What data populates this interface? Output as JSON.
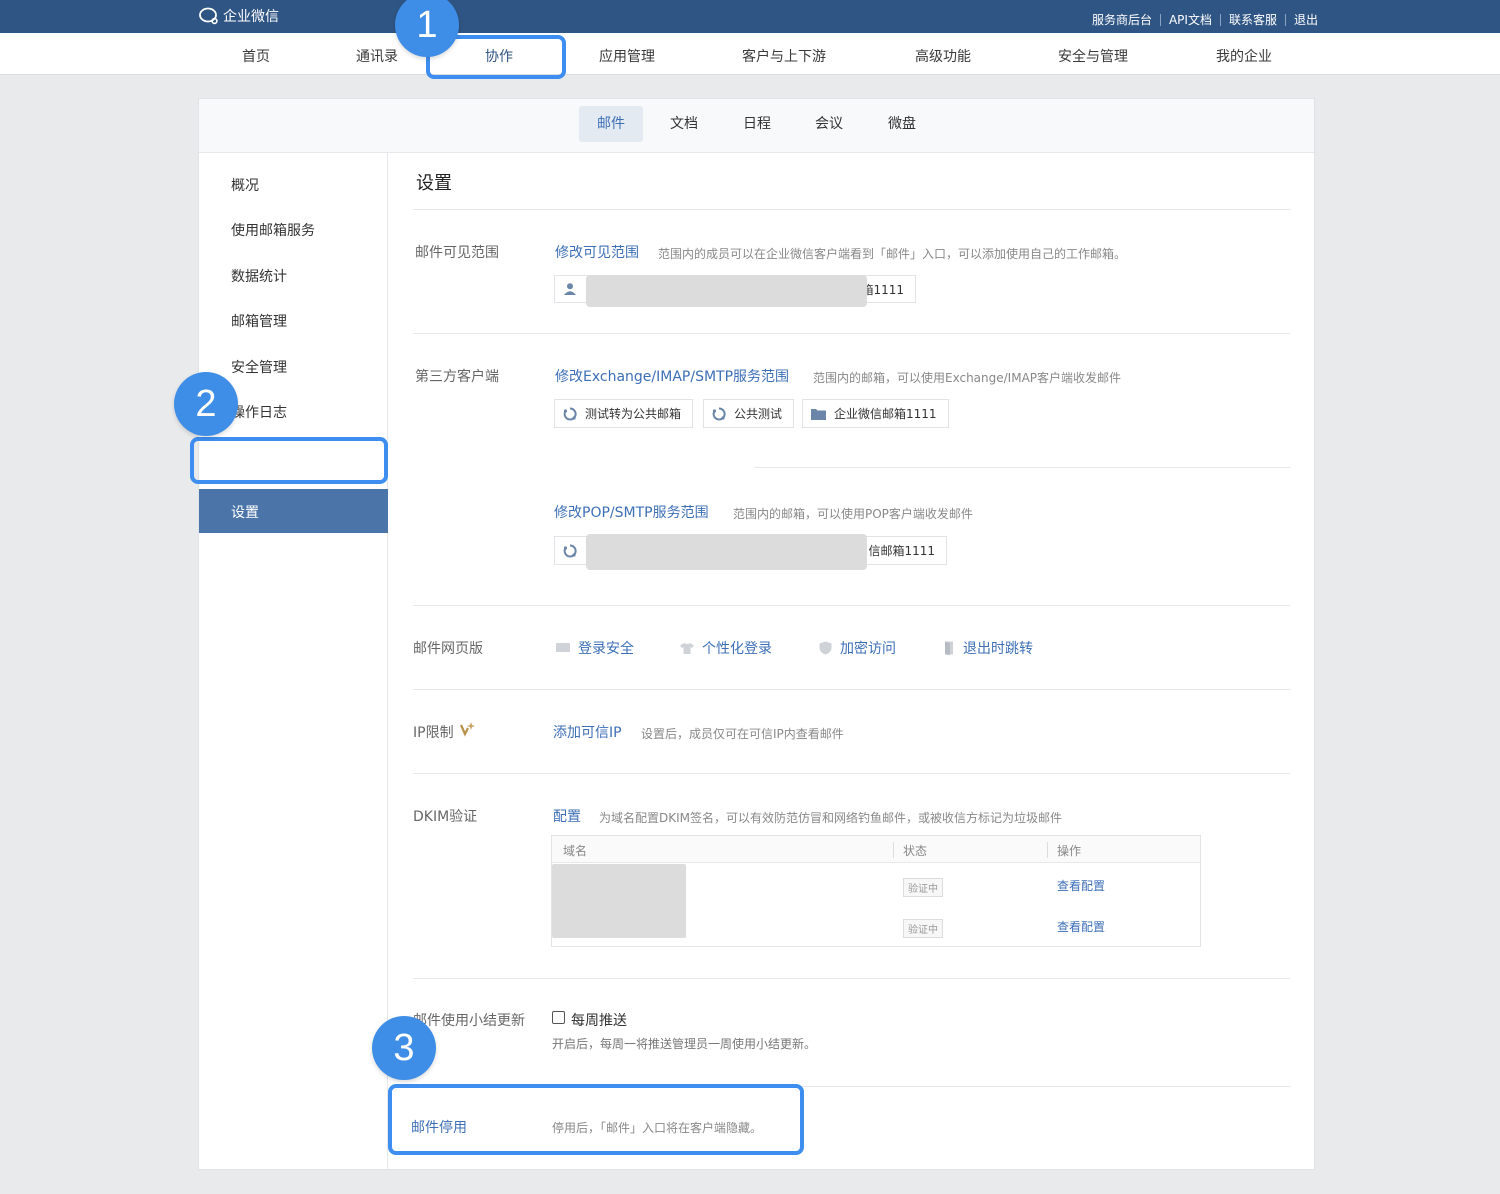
{
  "topbar": {
    "brand": "企业微信",
    "links": [
      "服务商后台",
      "API文档",
      "联系客服",
      "退出"
    ]
  },
  "mainnav": {
    "items": [
      "首页",
      "通讯录",
      "协作",
      "应用管理",
      "客户与上下游",
      "高级功能",
      "安全与管理",
      "我的企业"
    ],
    "active": "协作"
  },
  "subnav": {
    "tabs": [
      "邮件",
      "文档",
      "日程",
      "会议",
      "微盘"
    ],
    "active": "邮件"
  },
  "sidebar": {
    "items": [
      "概况",
      "使用邮箱服务",
      "数据统计",
      "邮箱管理",
      "安全管理",
      "操作日志",
      "设置"
    ],
    "active": "设置"
  },
  "content": {
    "title": "设置",
    "visibility": {
      "label": "邮件可见范围",
      "link": "修改可见范围",
      "desc": "范围内的成员可以在企业微信客户端看到「邮件」入口，可以添加使用自己的工作邮箱。",
      "chip_tail": "箱1111"
    },
    "third_party": {
      "label": "第三方客户端",
      "imap_link": "修改Exchange/IMAP/SMTP服务范围",
      "imap_desc": "范围内的邮箱，可以使用Exchange/IMAP客户端收发邮件",
      "imap_chips": [
        "测试转为公共邮箱",
        "公共测试",
        "企业微信邮箱1111"
      ],
      "pop_link": "修改POP/SMTP服务范围",
      "pop_desc": "范围内的邮箱，可以使用POP客户端收发邮件",
      "pop_chip_tail": "信邮箱1111"
    },
    "webmail": {
      "label": "邮件网页版",
      "items": [
        "登录安全",
        "个性化登录",
        "加密访问",
        "退出时跳转"
      ]
    },
    "ip": {
      "label": "IP限制",
      "link": "添加可信IP",
      "desc": "设置后，成员仅可在可信IP内查看邮件"
    },
    "dkim": {
      "label": "DKIM验证",
      "link": "配置",
      "desc": "为域名配置DKIM签名，可以有效防范仿冒和网络钓鱼邮件，或被收信方标记为垃圾邮件",
      "columns": [
        "域名",
        "状态",
        "操作"
      ],
      "rows": [
        {
          "status": "验证中",
          "action": "查看配置"
        },
        {
          "status": "验证中",
          "action": "查看配置"
        }
      ]
    },
    "summary": {
      "label": "邮件使用小结更新",
      "checkbox": "每周推送",
      "desc": "开启后，每周一将推送管理员一周使用小结更新。"
    },
    "disable": {
      "link": "邮件停用",
      "desc": "停用后，「邮件」入口将在客户端隐藏。"
    }
  },
  "annotations": [
    "1",
    "2",
    "3"
  ],
  "colors": {
    "topbar": "#2f5584",
    "accent": "#3d6fb6",
    "sidebar_active": "#4b74a8",
    "highlight": "#3d8ef0"
  }
}
